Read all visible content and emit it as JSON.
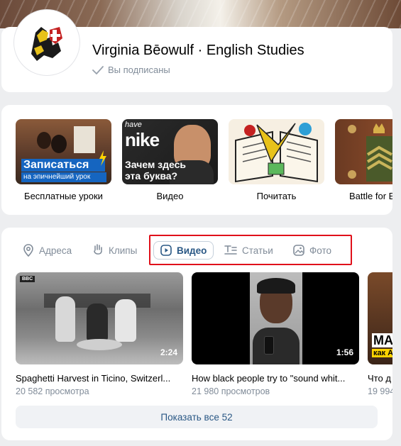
{
  "profile": {
    "name": "Virginia Bēowulf · English Studies",
    "status": "Вы подписаны"
  },
  "shelf": [
    {
      "label": "Бесплатные уроки",
      "overlay_title": "Записаться",
      "overlay_sub": "на эпичнейший урок"
    },
    {
      "label": "Видео",
      "overlay_brand": "nike",
      "overlay_top": "have",
      "overlay_title": "Зачем здесь",
      "overlay_sub": "эта буква?"
    },
    {
      "label": "Почитать"
    },
    {
      "label": "Battle for E"
    }
  ],
  "tabs": [
    {
      "label": "Адреса",
      "icon": "location-pin-icon"
    },
    {
      "label": "Клипы",
      "icon": "clips-icon"
    },
    {
      "label": "Видео",
      "icon": "video-icon",
      "active": true
    },
    {
      "label": "Статьи",
      "icon": "articles-icon"
    },
    {
      "label": "Фото",
      "icon": "photo-icon"
    }
  ],
  "videos": [
    {
      "title": "Spaghetti Harvest in Ticino, Switzerl...",
      "views": "20 582 просмотра",
      "duration": "2:24",
      "badge": "BBC"
    },
    {
      "title": "How black people try to \"sound whit...",
      "views": "21 980 просмотров",
      "duration": "1:56"
    },
    {
      "title": "Что д",
      "views": "19 994",
      "overlay": "MA",
      "overlay_sub": "как А"
    }
  ],
  "show_all": "Показать все 52",
  "colors": {
    "accent": "#2a5885",
    "muted": "#818c99",
    "highlight_box": "#e0101a"
  }
}
